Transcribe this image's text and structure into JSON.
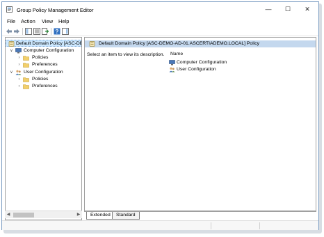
{
  "window": {
    "title": "Group Policy Management Editor",
    "minimize_glyph": "—",
    "maximize_glyph": "☐",
    "close_glyph": "✕"
  },
  "menu": {
    "items": [
      "File",
      "Action",
      "View",
      "Help"
    ]
  },
  "toolbar": {
    "buttons": [
      "back-icon",
      "forward-icon",
      "show-hide-tree-icon",
      "properties-icon",
      "export-list-icon",
      "help-icon",
      "show-hide-action-pane-icon"
    ]
  },
  "tree": {
    "root": "Default Domain Policy [ASC-DE",
    "computer_configuration": "Computer Configuration",
    "computer_policies": "Policies",
    "computer_preferences": "Preferences",
    "user_configuration": "User Configuration",
    "user_policies": "Policies",
    "user_preferences": "Preferences"
  },
  "content": {
    "header": "Default Domain Policy [ASC-DEMO-AD-01.ASCERTIADEMO.LOCAL] Policy",
    "description": "Select an item to view its description.",
    "column_name": "Name",
    "items": [
      "Computer Configuration",
      "User Configuration"
    ]
  },
  "tabs": {
    "extended": "Extended",
    "standard": "Standard"
  },
  "colors": {
    "selection": "#cce8ff",
    "header_band": "#c4d8ee",
    "window_border": "#7a9cc2"
  }
}
